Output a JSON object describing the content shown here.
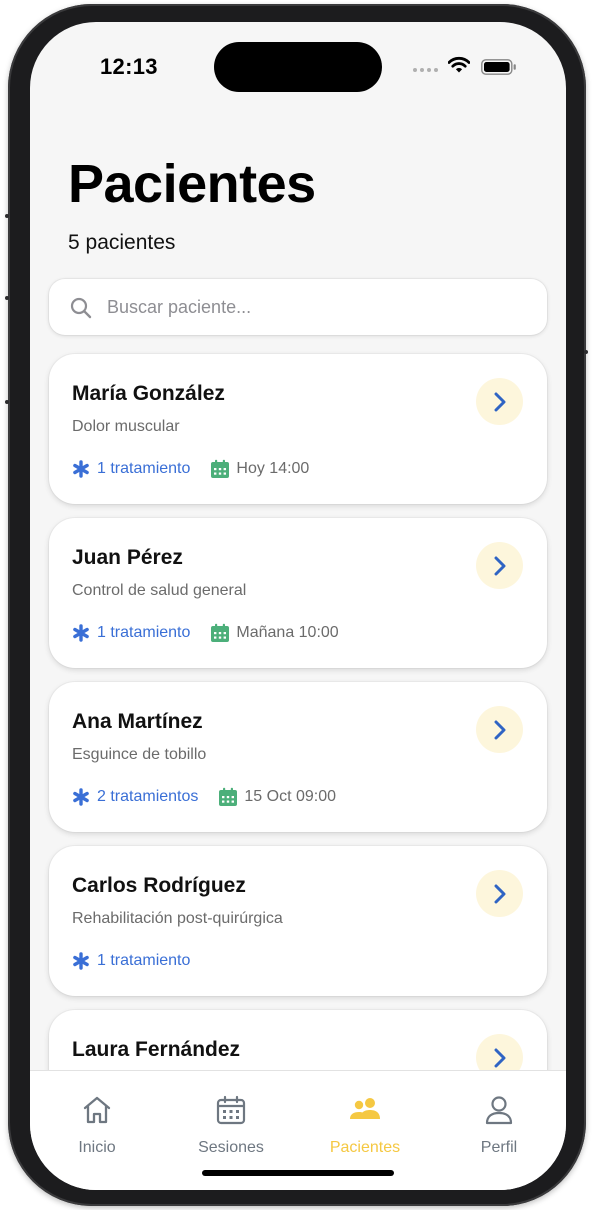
{
  "status_bar": {
    "time": "12:13"
  },
  "header": {
    "title": "Pacientes",
    "subtitle": "5 pacientes"
  },
  "search": {
    "placeholder": "Buscar paciente...",
    "value": ""
  },
  "patients": [
    {
      "name": "María González",
      "condition": "Dolor muscular",
      "treatments": "1 tratamiento",
      "appointment": "Hoy 14:00"
    },
    {
      "name": "Juan Pérez",
      "condition": "Control de salud general",
      "treatments": "1 tratamiento",
      "appointment": "Mañana 10:00"
    },
    {
      "name": "Ana Martínez",
      "condition": "Esguince de tobillo",
      "treatments": "2 tratamientos",
      "appointment": "15 Oct 09:00"
    },
    {
      "name": "Carlos Rodríguez",
      "condition": "Rehabilitación post-quirúrgica",
      "treatments": "1 tratamiento",
      "appointment": ""
    },
    {
      "name": "Laura Fernández",
      "condition": "",
      "treatments": "",
      "appointment": ""
    }
  ],
  "tab_bar": {
    "active": "Pacientes",
    "tabs": [
      {
        "label": "Inicio",
        "icon": "home-icon"
      },
      {
        "label": "Sesiones",
        "icon": "calendar-icon"
      },
      {
        "label": "Pacientes",
        "icon": "people-icon"
      },
      {
        "label": "Perfil",
        "icon": "person-icon"
      }
    ]
  },
  "colors": {
    "accent": "#f5c842",
    "link": "#3a6fd6",
    "appointment_icon": "#4caf7a",
    "chevron_bg": "#fdf6dc",
    "background": "#f6f6f6"
  }
}
